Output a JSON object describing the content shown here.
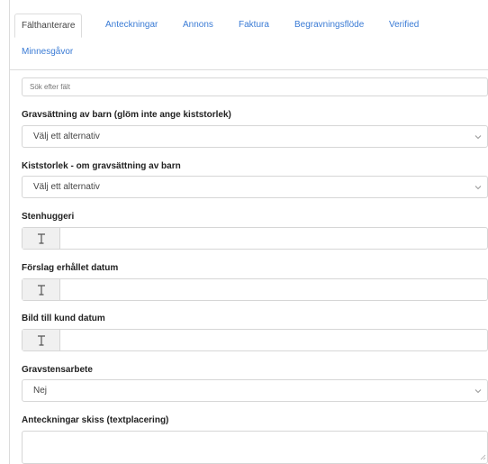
{
  "tabs": [
    {
      "label": "Fälthanterare",
      "active": true
    },
    {
      "label": "Anteckningar",
      "active": false
    },
    {
      "label": "Annons",
      "active": false
    },
    {
      "label": "Faktura",
      "active": false
    },
    {
      "label": "Begravningsflöde",
      "active": false
    },
    {
      "label": "Verified",
      "active": false
    },
    {
      "label": "Minnesgåvor",
      "active": false
    }
  ],
  "search": {
    "placeholder": "Sök efter fält"
  },
  "fields": {
    "gravsattning_barn": {
      "label": "Gravsättning av barn (glöm inte ange kiststorlek)",
      "value": "Välj ett alternativ"
    },
    "kiststorlek": {
      "label": "Kiststorlek - om gravsättning av barn",
      "value": "Välj ett alternativ"
    },
    "stenhuggeri": {
      "label": "Stenhuggeri",
      "value": ""
    },
    "forslag_datum": {
      "label": "Förslag erhållet datum",
      "value": ""
    },
    "bild_kund_datum": {
      "label": "Bild till kund datum",
      "value": ""
    },
    "gravstensarbete": {
      "label": "Gravstensarbete",
      "value": "Nej"
    },
    "anteckningar_skiss": {
      "label": "Anteckningar skiss (textplacering)",
      "value": ""
    }
  },
  "icons": {
    "text_field": "text-cursor-icon",
    "dropdown": "chevron-down-icon",
    "resize": "resize-grip-icon"
  },
  "colors": {
    "link": "#3a7bd5",
    "border": "#d6d6d6",
    "addon_bg": "#f0f0f0"
  }
}
